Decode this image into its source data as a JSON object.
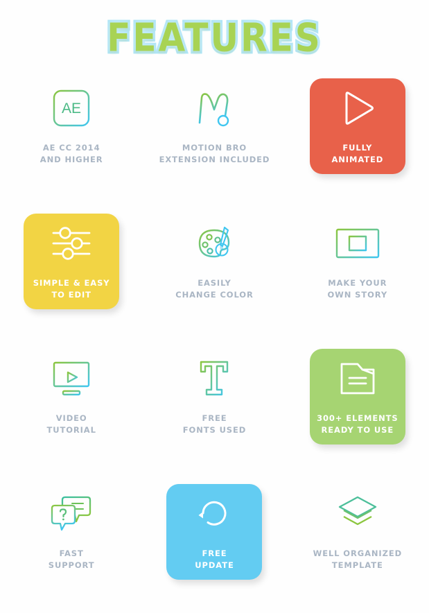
{
  "header": {
    "title": "FEATURES",
    "title_fill_color": "#a8d354",
    "title_outline_color": "#aee4f5"
  },
  "theme": {
    "background": "#fefefe",
    "label_color": "#aab6c4",
    "highlight_label_color": "#ffffff",
    "icon_gradient_start": "#8cc63f",
    "icon_gradient_end": "#3fc6f0"
  },
  "features": [
    {
      "id": "ae-cc-2014",
      "icon": "ae-logo-icon",
      "label": "AE CC 2014\nAND HIGHER",
      "highlighted": false,
      "card_color": null
    },
    {
      "id": "motion-bro",
      "icon": "motion-bro-m-icon",
      "label": "MOTION BRO\nEXTENSION INCLUDED",
      "highlighted": false,
      "card_color": null
    },
    {
      "id": "fully-animated",
      "icon": "play-triangle-icon",
      "label": "FULLY\nANIMATED",
      "highlighted": true,
      "card_color": "#e8614a"
    },
    {
      "id": "simple-easy-to-edit",
      "icon": "sliders-icon",
      "label": "SIMPLE & EASY\nTO EDIT",
      "highlighted": true,
      "card_color": "#f2d444"
    },
    {
      "id": "easily-change-color",
      "icon": "paint-palette-icon",
      "label": "EASILY\nCHANGE COLOR",
      "highlighted": false,
      "card_color": null
    },
    {
      "id": "make-your-own-story",
      "icon": "film-strip-icon",
      "label": "MAKE YOUR\nOWN STORY",
      "highlighted": false,
      "card_color": null
    },
    {
      "id": "video-tutorial",
      "icon": "monitor-play-icon",
      "label": "VIDEO\nTUTORIAL",
      "highlighted": false,
      "card_color": null
    },
    {
      "id": "free-fonts-used",
      "icon": "serif-t-icon",
      "label": "FREE\nFONTS USED",
      "highlighted": false,
      "card_color": null
    },
    {
      "id": "300-elements",
      "icon": "folder-document-icon",
      "label": "300+ ELEMENTS\nREADY TO USE",
      "highlighted": true,
      "card_color": "#a6d472"
    },
    {
      "id": "fast-support",
      "icon": "chat-bubbles-question-icon",
      "label": "FAST\nSUPPORT",
      "highlighted": false,
      "card_color": null
    },
    {
      "id": "free-update",
      "icon": "refresh-circle-icon",
      "label": "FREE\nUPDATE",
      "highlighted": true,
      "card_color": "#63ccf2"
    },
    {
      "id": "well-organized-template",
      "icon": "layers-stack-icon",
      "label": "WELL ORGANIZED\nTEMPLATE",
      "highlighted": false,
      "card_color": null
    }
  ]
}
